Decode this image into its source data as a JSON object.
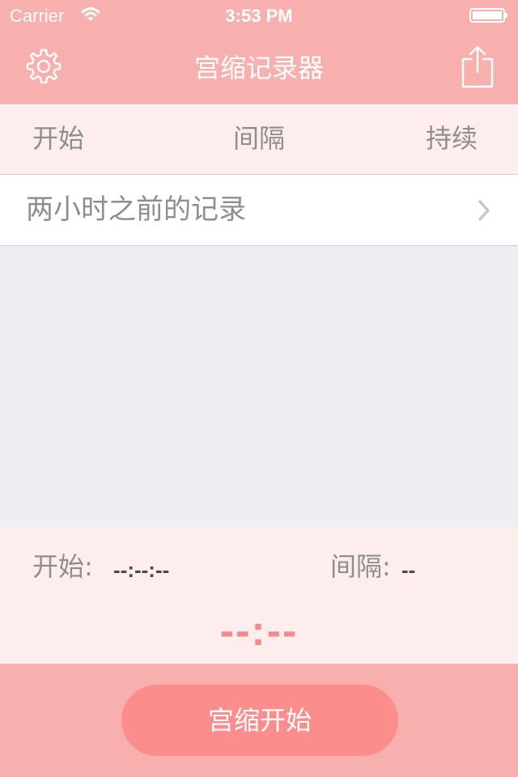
{
  "status_bar": {
    "carrier": "Carrier",
    "time": "3:53 PM",
    "wifi_icon": "wifi-icon",
    "battery_icon": "battery-icon"
  },
  "nav": {
    "title": "宫缩记录器",
    "settings_icon": "gear-icon",
    "share_icon": "share-icon"
  },
  "columns": {
    "start": "开始",
    "interval": "间隔",
    "duration": "持续"
  },
  "history": {
    "label": "两小时之前的记录",
    "chevron_icon": "chevron-right-icon"
  },
  "info": {
    "start_label": "开始:",
    "start_value": "--:--:--",
    "interval_label": "间隔:",
    "interval_value": "--",
    "timer": "--:--"
  },
  "action": {
    "start_button_label": "宫缩开始"
  },
  "colors": {
    "theme": "#f7b0ae",
    "panel": "#fdeeed",
    "accent": "#fb8d8d",
    "timer": "#f4898a",
    "background": "#efeef3"
  }
}
